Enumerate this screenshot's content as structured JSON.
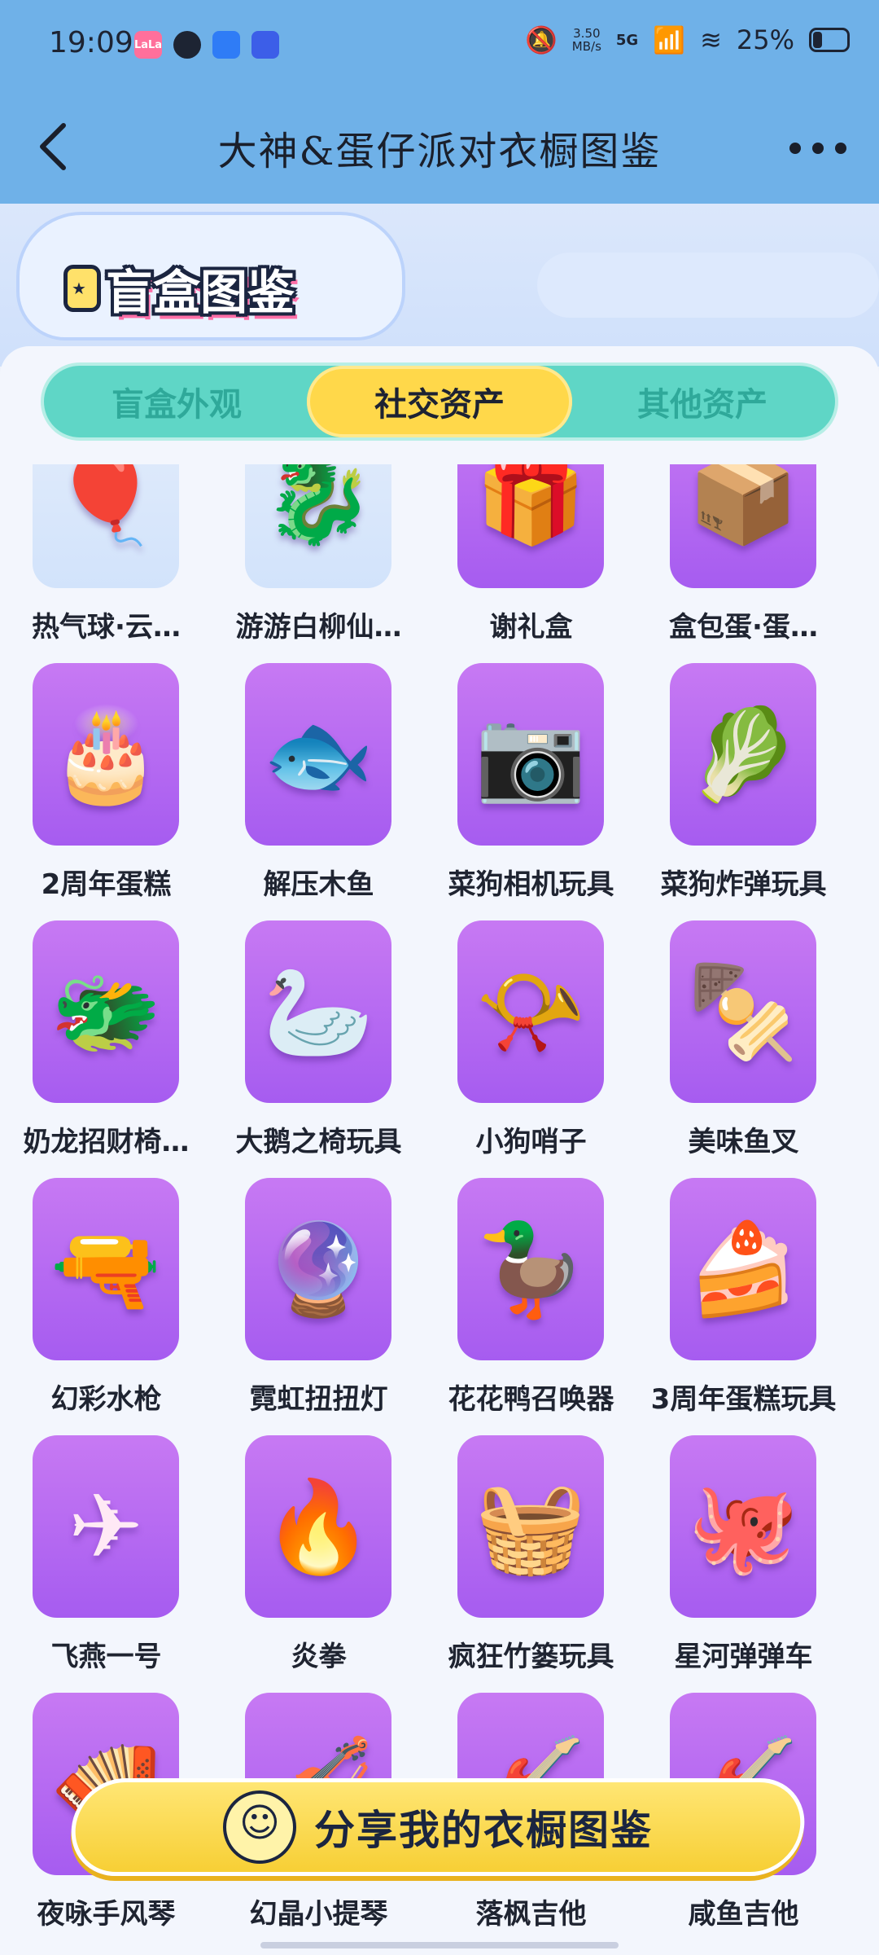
{
  "status_bar": {
    "time": "19:09",
    "apps": [
      "LaLa",
      "",
      "",
      ""
    ],
    "network_speed": "3.50\nMB/s",
    "network_label": "5G",
    "battery": "25%"
  },
  "title_bar": {
    "title": "大神&蛋仔派对衣橱图鉴"
  },
  "banner": {
    "title": "盲盒图鉴"
  },
  "tabs": [
    {
      "label": "盲盒外观",
      "active": false
    },
    {
      "label": "社交资产",
      "active": true
    },
    {
      "label": "其他资产",
      "active": false
    }
  ],
  "items": [
    {
      "label": "热气球·云…",
      "icon": "hot-air-balloon-icon",
      "glyph": "🎈",
      "light": true
    },
    {
      "label": "游游白柳仙…",
      "icon": "white-dragon-icon",
      "glyph": "🐉",
      "light": true
    },
    {
      "label": "谢礼盒",
      "icon": "gift-box-icon",
      "glyph": "🎁",
      "light": false
    },
    {
      "label": "盒包蛋·蛋…",
      "icon": "yellow-box-icon",
      "glyph": "📦",
      "light": false
    },
    {
      "label": "2周年蛋糕",
      "icon": "cake-icon",
      "glyph": "🎂",
      "light": false
    },
    {
      "label": "解压木鱼",
      "icon": "fish-toy-icon",
      "glyph": "🐟",
      "light": false
    },
    {
      "label": "菜狗相机玩具",
      "icon": "camera-toy-icon",
      "glyph": "📷",
      "light": false
    },
    {
      "label": "菜狗炸弹玩具",
      "icon": "cabbage-dog-icon",
      "glyph": "🥬",
      "light": false
    },
    {
      "label": "奶龙招财椅…",
      "icon": "lucky-dragon-icon",
      "glyph": "🐲",
      "light": false
    },
    {
      "label": "大鹅之椅玩具",
      "icon": "goose-chair-icon",
      "glyph": "🦢",
      "light": false
    },
    {
      "label": "小狗哨子",
      "icon": "whistle-icon",
      "glyph": "📯",
      "light": false
    },
    {
      "label": "美味鱼叉",
      "icon": "skewer-icon",
      "glyph": "🍢",
      "light": false
    },
    {
      "label": "幻彩水枪",
      "icon": "water-gun-icon",
      "glyph": "🔫",
      "light": false
    },
    {
      "label": "霓虹扭扭灯",
      "icon": "neon-lamp-icon",
      "glyph": "🔮",
      "light": false
    },
    {
      "label": "花花鸭召唤器",
      "icon": "duck-icon",
      "glyph": "🦆",
      "light": false
    },
    {
      "label": "3周年蛋糕玩具",
      "icon": "cake-three-icon",
      "glyph": "🍰",
      "light": false
    },
    {
      "label": "飞燕一号",
      "icon": "boomerang-icon",
      "glyph": "✈",
      "light": false
    },
    {
      "label": "炎拳",
      "icon": "fire-fist-icon",
      "glyph": "🔥",
      "light": false
    },
    {
      "label": "疯狂竹篓玩具",
      "icon": "basket-icon",
      "glyph": "🧺",
      "light": false
    },
    {
      "label": "星河弹弹车",
      "icon": "octopus-car-icon",
      "glyph": "🐙",
      "light": false
    },
    {
      "label": "夜咏手风琴",
      "icon": "accordion-icon",
      "glyph": "🪗",
      "light": false
    },
    {
      "label": "幻晶小提琴",
      "icon": "violin-icon",
      "glyph": "🎻",
      "light": false
    },
    {
      "label": "落枫吉他",
      "icon": "guitar-icon",
      "glyph": "🎸",
      "light": false
    },
    {
      "label": "咸鱼吉他",
      "icon": "fish-guitar-icon",
      "glyph": "🎸",
      "light": false
    }
  ],
  "share_button": {
    "label": "分享我的衣橱图鉴"
  }
}
